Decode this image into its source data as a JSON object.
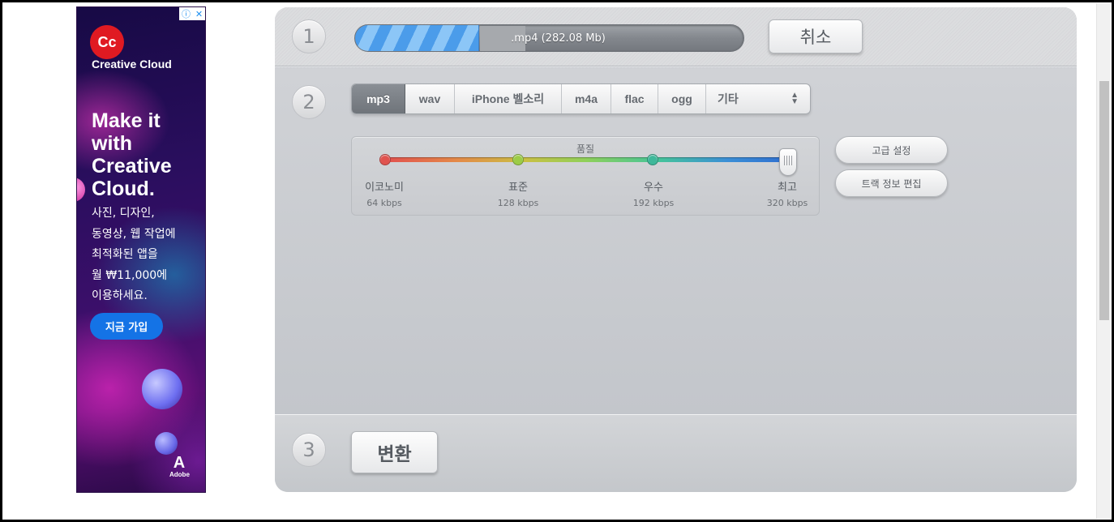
{
  "ad": {
    "brand_logo_text": "Cc",
    "brand": "Creative Cloud",
    "headline": "Make it with Creative Cloud.",
    "body_lines": [
      "사진, 디자인,",
      "동영상, 웹 작업에",
      "최적화된 앱을",
      "월 ₩11,000에",
      "이용하세요."
    ],
    "cta": "지금 가입",
    "adobe_glyph": "A",
    "adobe_label": "Adobe",
    "info_glyph": "ⓘ",
    "close_glyph": "✕"
  },
  "steps": {
    "step1": "1",
    "step2": "2",
    "step3": "3"
  },
  "upload": {
    "filename_text": ".mp4 (282.08 Mb)",
    "progress_fraction": 0.32,
    "cancel_label": "취소"
  },
  "formats": {
    "tabs": [
      "mp3",
      "wav",
      "iPhone 벨소리",
      "m4a",
      "flac",
      "ogg"
    ],
    "active_index": 0,
    "other_label": "기타"
  },
  "quality": {
    "title": "품질",
    "levels": [
      {
        "label": "이코노미",
        "bitrate": "64 kbps",
        "color": "#e0534f"
      },
      {
        "label": "표준",
        "bitrate": "128 kbps",
        "color": "#9ccc47"
      },
      {
        "label": "우수",
        "bitrate": "192 kbps",
        "color": "#3fb89a"
      },
      {
        "label": "최고",
        "bitrate": "320 kbps",
        "color": "#2f6fd0"
      }
    ],
    "selected_index": 3
  },
  "side_buttons": {
    "advanced": "고급 설정",
    "track_info": "트랙 정보 편집"
  },
  "convert": {
    "label": "변환"
  }
}
